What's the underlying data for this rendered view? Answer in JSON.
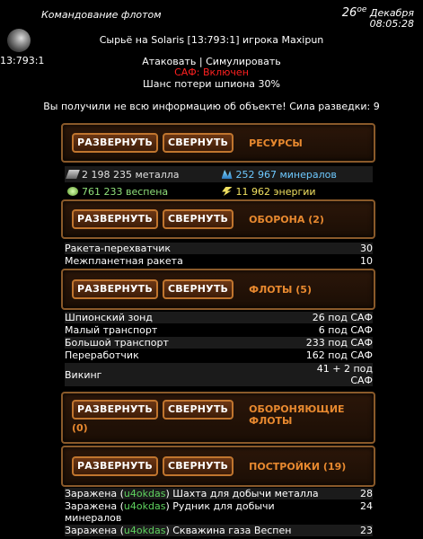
{
  "header": {
    "title": "Командование флотом",
    "date_day": "26",
    "date_suffix": "ое",
    "date_month": "Декабря",
    "time": "08:05:28"
  },
  "planet": {
    "coords": "13:793:1"
  },
  "report": {
    "heading": "Сырьё на Solaris [13:793:1] игрока Maxipun",
    "attack_label": "Атаковать",
    "separator": "|",
    "simulate_label": "Симулировать",
    "saf_status": "САФ: Включен",
    "spy_loss": "Шанс потери шпиона 30%",
    "info_warning": "Вы получили не всю информацию об объекте! Сила разведки: 9"
  },
  "buttons": {
    "expand": "РАЗВЕРНУТЬ",
    "collapse": "СВЕРНУТЬ"
  },
  "sections": {
    "resources": {
      "title": "РЕСУРСЫ"
    },
    "defense": {
      "title": "ОБОРОНА (2)"
    },
    "fleets": {
      "title": "ФЛОТЫ (5)"
    },
    "defending_fleets": {
      "title": "ОБОРОНЯЮЩИЕ ФЛОТЫ",
      "count": "(0)"
    },
    "buildings": {
      "title": "ПОСТРОЙКИ (19)"
    }
  },
  "resources": {
    "metal": "2 198 235 металла",
    "minerals": "252 967 минералов",
    "vespene": "761 233 веспена",
    "energy": "11 962 энергии"
  },
  "defense_rows": [
    {
      "name": "Ракета-перехватчик",
      "value": "30"
    },
    {
      "name": "Межпланетная ракета",
      "value": "10"
    }
  ],
  "fleet_rows": [
    {
      "name": "Шпионский зонд",
      "value": "26 под САФ"
    },
    {
      "name": "Малый транспорт",
      "value": "6 под САФ"
    },
    {
      "name": "Большой транспорт",
      "value": "233 под САФ"
    },
    {
      "name": "Переработчик",
      "value": "162 под САФ"
    },
    {
      "name": "Викинг",
      "value_line1": "41 + 2 под",
      "value_line2": "САФ"
    }
  ],
  "building_rows": [
    {
      "prefix": "Заражена (",
      "who": "u4okdas",
      "suffix": ")",
      "name": "Шахта для добычи металла",
      "value": "28"
    },
    {
      "prefix": "Заражена (",
      "who": "u4okdas",
      "suffix": ")",
      "name_line1": "Рудник для добычи",
      "name_line2": "минералов",
      "value": "24"
    },
    {
      "prefix": "Заражена (",
      "who": "u4okdas",
      "suffix": ")",
      "name": "Скважина газа Веспен",
      "value": "23"
    }
  ],
  "colors": {
    "accent": "#e8892f",
    "saf": "#ff2020",
    "infected": "#5fd35f",
    "minerals": "#6ec9ff",
    "vespene": "#8fe07a",
    "energy": "#f0e060"
  }
}
